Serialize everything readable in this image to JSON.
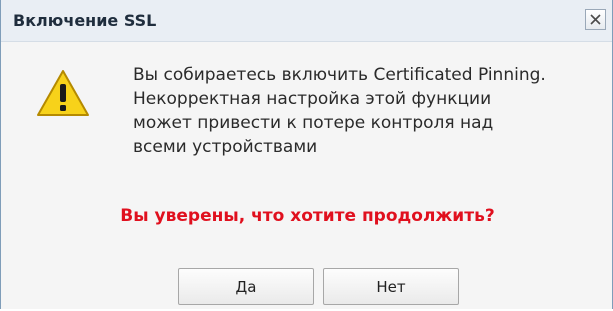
{
  "dialog": {
    "title": "Включение SSL",
    "close_icon": "close-icon",
    "warning_icon": "warning-icon",
    "message": "Вы собираетесь включить Certificated Pinning. Некорректная настройка этой функции может привести к потере контроля над всеми устройствами",
    "message_lines": [
      "Вы собираетесь включить Certificated Pinning.",
      "Некорректная настройка этой функции",
      "может привести к потере контроля над",
      "всеми устройствами"
    ],
    "question": "Вы уверены, что хотите продолжить?",
    "buttons": {
      "yes": "Да",
      "no": "Нет"
    }
  },
  "colors": {
    "question_text": "#e0101e",
    "warning_fill": "#f7d21a",
    "titlebar_bg": "#e9eef4",
    "body_bg": "#f5f5f5"
  }
}
